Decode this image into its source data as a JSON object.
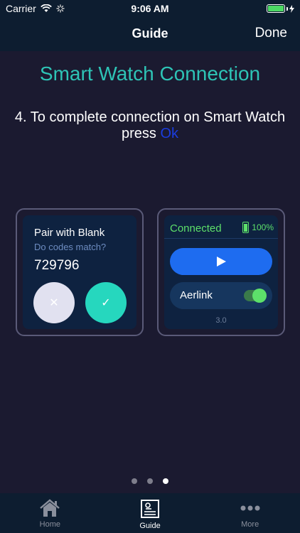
{
  "status_bar": {
    "carrier": "Carrier",
    "time": "9:06 AM"
  },
  "nav": {
    "title": "Guide",
    "done_label": "Done"
  },
  "content": {
    "headline": "Smart Watch Connection",
    "instruction": "4. To complete connection on Smart Watch press",
    "ok_word": "Ok"
  },
  "watch_pair": {
    "title": "Pair with Blank",
    "subtitle": "Do codes match?",
    "code": "729796",
    "decline_glyph": "✕",
    "accept_glyph": "✓"
  },
  "watch_connected": {
    "status": "Connected",
    "battery": "100%",
    "app_name": "Aerlink",
    "version": "3.0",
    "toggle_on": true
  },
  "page_indicator": {
    "count": 3,
    "active_index": 2
  },
  "tabs": [
    {
      "label": "Home",
      "icon": "home-icon"
    },
    {
      "label": "Guide",
      "icon": "guide-icon"
    },
    {
      "label": "More",
      "icon": "more-icon"
    }
  ],
  "colors": {
    "accent_teal": "#2ec4b6",
    "ok_blue": "#1a3de0",
    "connected_green": "#5de06a",
    "play_blue": "#1e6cf0"
  }
}
